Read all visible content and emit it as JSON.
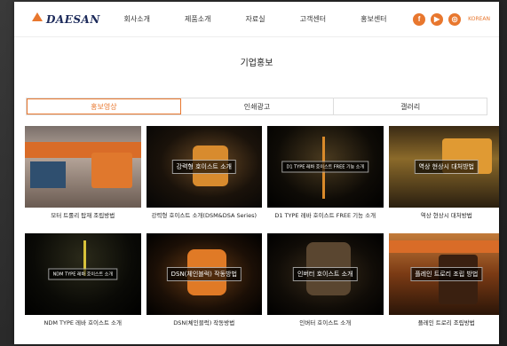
{
  "header": {
    "logo_text": "DAESAN",
    "nav": [
      "회사소개",
      "제품소개",
      "자료실",
      "고객센터",
      "홍보센터"
    ],
    "social": [
      {
        "icon": "facebook-icon",
        "glyph": "f"
      },
      {
        "icon": "youtube-icon",
        "glyph": "▶"
      },
      {
        "icon": "instagram-icon",
        "glyph": "◎"
      }
    ],
    "lang": "KOREAN"
  },
  "page_title": "기업홍보",
  "tabs": [
    {
      "label": "홍보영상",
      "active": true
    },
    {
      "label": "인쇄광고",
      "active": false
    },
    {
      "label": "갤러리",
      "active": false
    }
  ],
  "videos": [
    {
      "caption": "모터 트롤리 탑재 조립방법",
      "overlay": ""
    },
    {
      "caption": "강력형 호이스트 소개(DSM&DSA Series)",
      "overlay": "강력형 호이스트 소개"
    },
    {
      "caption": "D1 TYPE 레바 호이스트 FREE 기능 소개",
      "overlay": "D1 TYPE 레바 호이스트 FREE 기능 소개"
    },
    {
      "caption": "역상 현상시 대처방법",
      "overlay": "역상 현상시 대처방법"
    },
    {
      "caption": "NDM TYPE 레바 호이스트 소개",
      "overlay": "NDM TYPE 레바 호이스트 소개"
    },
    {
      "caption": "DSN(체인블럭) 작동방법",
      "overlay": "DSN(체인블럭) 작동방법"
    },
    {
      "caption": "인버터 호이스트 소개",
      "overlay": "인버터 호이스트 소개"
    },
    {
      "caption": "플레인 트로리 조립방법",
      "overlay": "플레인 트로리 조립 방법"
    }
  ],
  "colors": {
    "accent": "#e8772e",
    "logo": "#1c2a5a"
  }
}
